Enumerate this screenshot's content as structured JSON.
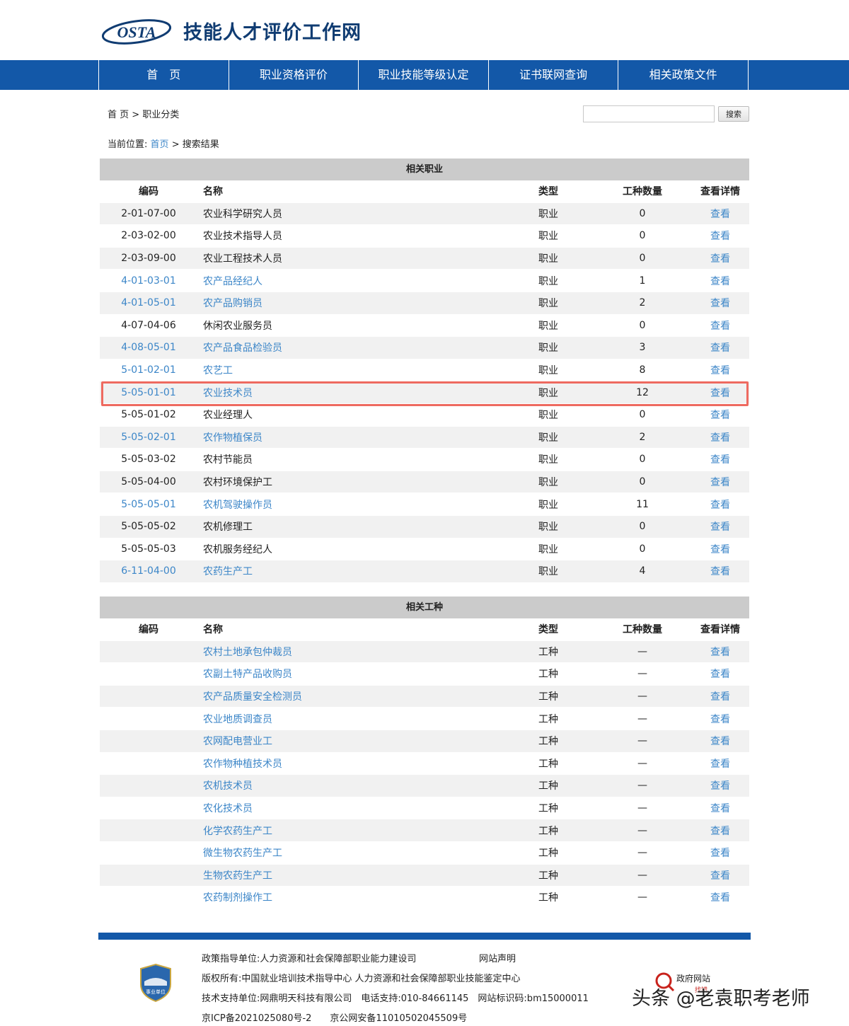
{
  "header": {
    "logo_text": "OSTA",
    "site_title": "技能人才评价工作网"
  },
  "nav": {
    "items": [
      "首　页",
      "职业资格评价",
      "职业技能等级认定",
      "证书联网查询",
      "相关政策文件"
    ]
  },
  "breadcrumb": {
    "home": "首 页",
    "sep": ">",
    "current": "职业分类"
  },
  "search": {
    "placeholder": "",
    "button": "搜索"
  },
  "location": {
    "label": "当前位置:",
    "home": "首页",
    "sep": ">",
    "current": "搜索结果"
  },
  "occupations": {
    "title": "相关职业",
    "headers": {
      "code": "编码",
      "name": "名称",
      "type": "类型",
      "count": "工种数量",
      "view": "查看详情"
    },
    "rows": [
      {
        "code": "2-01-07-00",
        "name": "农业科学研究人员",
        "type": "职业",
        "count": "0",
        "view": "查看",
        "linked": false
      },
      {
        "code": "2-03-02-00",
        "name": "农业技术指导人员",
        "type": "职业",
        "count": "0",
        "view": "查看",
        "linked": false
      },
      {
        "code": "2-03-09-00",
        "name": "农业工程技术人员",
        "type": "职业",
        "count": "0",
        "view": "查看",
        "linked": false
      },
      {
        "code": "4-01-03-01",
        "name": "农产品经纪人",
        "type": "职业",
        "count": "1",
        "view": "查看",
        "linked": true
      },
      {
        "code": "4-01-05-01",
        "name": "农产品购销员",
        "type": "职业",
        "count": "2",
        "view": "查看",
        "linked": true
      },
      {
        "code": "4-07-04-06",
        "name": "休闲农业服务员",
        "type": "职业",
        "count": "0",
        "view": "查看",
        "linked": false
      },
      {
        "code": "4-08-05-01",
        "name": "农产品食品检验员",
        "type": "职业",
        "count": "3",
        "view": "查看",
        "linked": true
      },
      {
        "code": "5-01-02-01",
        "name": "农艺工",
        "type": "职业",
        "count": "8",
        "view": "查看",
        "linked": true
      },
      {
        "code": "5-05-01-01",
        "name": "农业技术员",
        "type": "职业",
        "count": "12",
        "view": "查看",
        "linked": true
      },
      {
        "code": "5-05-01-02",
        "name": "农业经理人",
        "type": "职业",
        "count": "0",
        "view": "查看",
        "linked": false
      },
      {
        "code": "5-05-02-01",
        "name": "农作物植保员",
        "type": "职业",
        "count": "2",
        "view": "查看",
        "linked": true
      },
      {
        "code": "5-05-03-02",
        "name": "农村节能员",
        "type": "职业",
        "count": "0",
        "view": "查看",
        "linked": false
      },
      {
        "code": "5-05-04-00",
        "name": "农村环境保护工",
        "type": "职业",
        "count": "0",
        "view": "查看",
        "linked": false
      },
      {
        "code": "5-05-05-01",
        "name": "农机驾驶操作员",
        "type": "职业",
        "count": "11",
        "view": "查看",
        "linked": true
      },
      {
        "code": "5-05-05-02",
        "name": "农机修理工",
        "type": "职业",
        "count": "0",
        "view": "查看",
        "linked": false
      },
      {
        "code": "5-05-05-03",
        "name": "农机服务经纪人",
        "type": "职业",
        "count": "0",
        "view": "查看",
        "linked": false
      },
      {
        "code": "6-11-04-00",
        "name": "农药生产工",
        "type": "职业",
        "count": "4",
        "view": "查看",
        "linked": true
      }
    ]
  },
  "trades": {
    "title": "相关工种",
    "headers": {
      "code": "编码",
      "name": "名称",
      "type": "类型",
      "count": "工种数量",
      "view": "查看详情"
    },
    "rows": [
      {
        "code": "",
        "name": "农村土地承包仲裁员",
        "type": "工种",
        "count": "—",
        "view": "查看"
      },
      {
        "code": "",
        "name": "农副土特产品收购员",
        "type": "工种",
        "count": "—",
        "view": "查看"
      },
      {
        "code": "",
        "name": "农产品质量安全检测员",
        "type": "工种",
        "count": "—",
        "view": "查看"
      },
      {
        "code": "",
        "name": "农业地质调查员",
        "type": "工种",
        "count": "—",
        "view": "查看"
      },
      {
        "code": "",
        "name": "农网配电营业工",
        "type": "工种",
        "count": "—",
        "view": "查看"
      },
      {
        "code": "",
        "name": "农作物种植技术员",
        "type": "工种",
        "count": "—",
        "view": "查看"
      },
      {
        "code": "",
        "name": "农机技术员",
        "type": "工种",
        "count": "—",
        "view": "查看"
      },
      {
        "code": "",
        "name": "农化技术员",
        "type": "工种",
        "count": "—",
        "view": "查看"
      },
      {
        "code": "",
        "name": "化学农药生产工",
        "type": "工种",
        "count": "—",
        "view": "查看"
      },
      {
        "code": "",
        "name": "微生物农药生产工",
        "type": "工种",
        "count": "—",
        "view": "查看"
      },
      {
        "code": "",
        "name": "生物农药生产工",
        "type": "工种",
        "count": "—",
        "view": "查看"
      },
      {
        "code": "",
        "name": "农药制剂操作工",
        "type": "工种",
        "count": "—",
        "view": "查看"
      }
    ]
  },
  "footer": {
    "badge_text": "事业单位",
    "line1": "政策指导单位:人力资源和社会保障部职业能力建设司",
    "statement": "网站声明",
    "line2": "版权所有:中国就业培训技术指导中心 人力资源和社会保障部职业技能鉴定中心",
    "line3": "技术支持单位:网鼎明天科技有限公司　电话支持:010-84661145　网站标识码:bm15000011",
    "line4": "京ICP备2021025080号-2　　京公网安备11010502045509号",
    "gov_badge": "政府网站",
    "gov_badge_sub": "找错"
  },
  "watermark": "头条 @老袁职考老师",
  "colors": {
    "nav_bg": "#1358a8",
    "link": "#3c86c8",
    "highlight": "#ee6a60",
    "table_title_bg": "#cbcbcb"
  }
}
